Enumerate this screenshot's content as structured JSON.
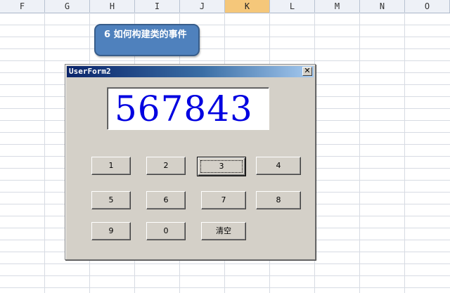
{
  "sheet": {
    "columns": [
      "F",
      "G",
      "H",
      "I",
      "J",
      "K",
      "L",
      "M",
      "N",
      "O"
    ],
    "selected_column": "K"
  },
  "callout": {
    "text": "6 如何构建类的事件"
  },
  "userform": {
    "title": "UserForm2",
    "close_label": "✕",
    "display_value": "567843",
    "buttons": [
      {
        "label": "1"
      },
      {
        "label": "2"
      },
      {
        "label": "3"
      },
      {
        "label": "4"
      },
      {
        "label": "5"
      },
      {
        "label": "6"
      },
      {
        "label": "7"
      },
      {
        "label": "8"
      },
      {
        "label": "9"
      },
      {
        "label": "0"
      },
      {
        "label": "清空"
      }
    ],
    "focused_button": "3"
  },
  "colors": {
    "display_text": "#0000e0",
    "callout_fill": "#4f81bd",
    "selected_column_header": "#f5c77a"
  }
}
